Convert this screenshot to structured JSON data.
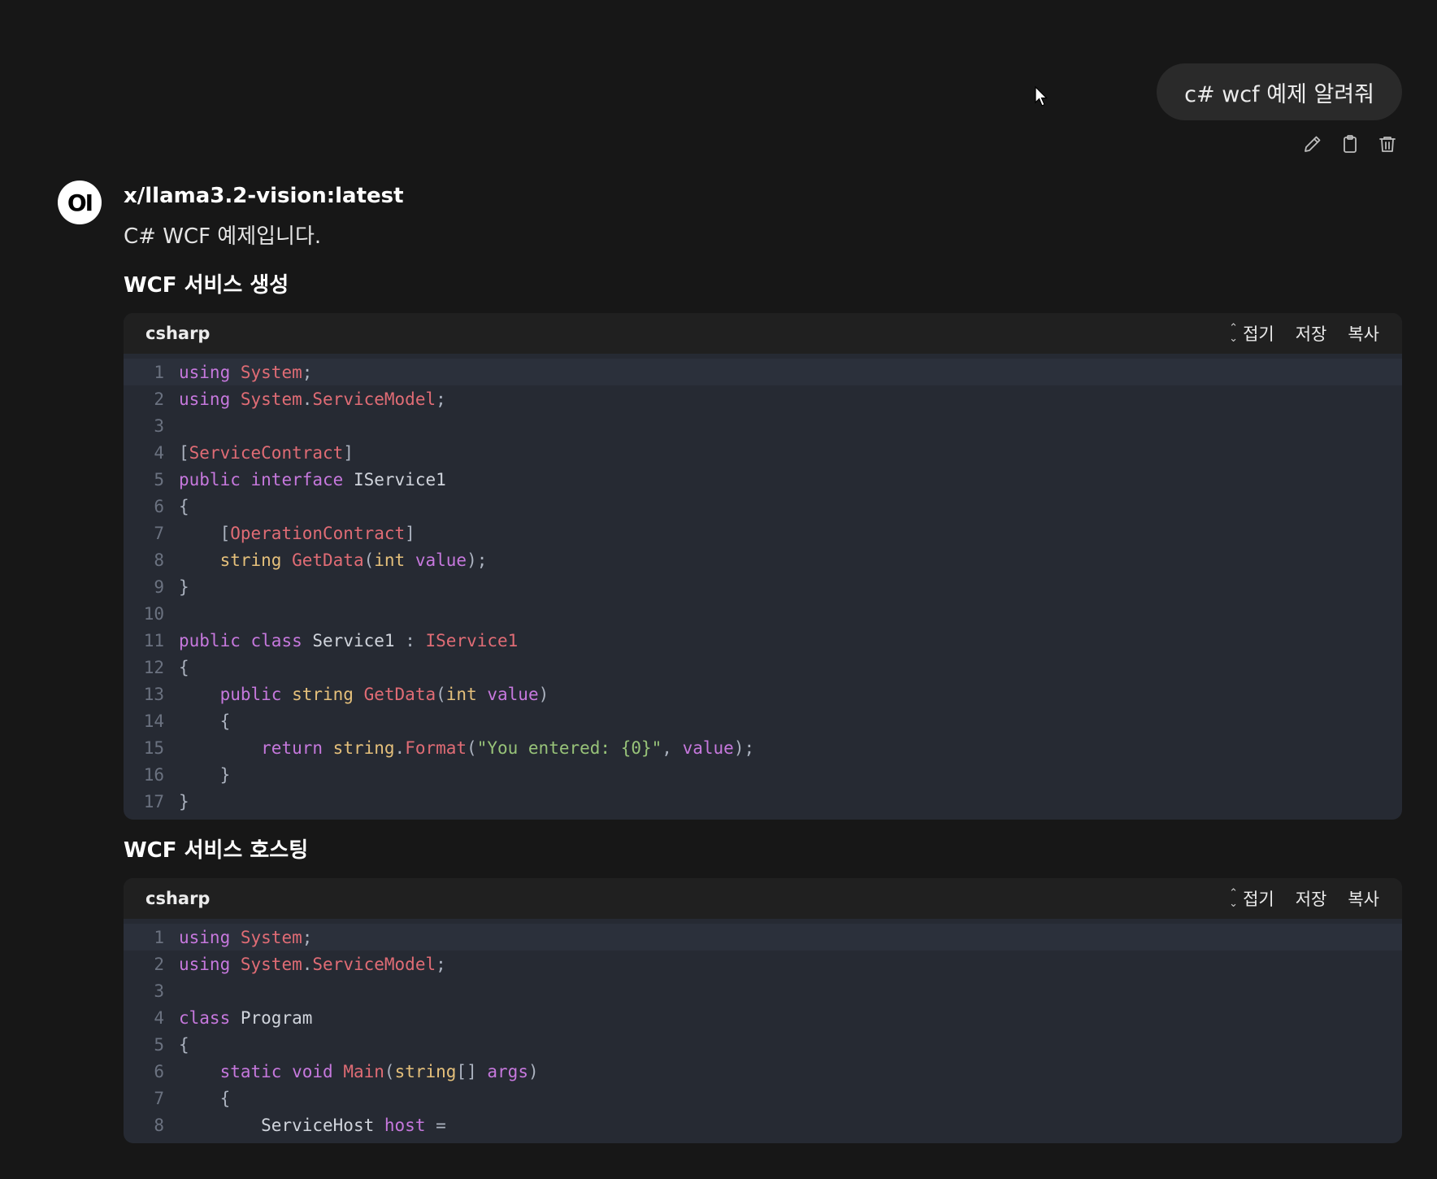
{
  "user_message": {
    "text": "c# wcf 예제 알려줘",
    "actions": [
      "edit-icon",
      "copy-icon",
      "delete-icon"
    ]
  },
  "assistant": {
    "avatar_text": "OI",
    "model_name": "x/llama3.2-vision:latest",
    "intro": "C# WCF 예제입니다.",
    "sections": [
      {
        "heading": "WCF 서비스 생성",
        "code_block": {
          "language": "csharp",
          "actions": {
            "collapse": "접기",
            "save": "저장",
            "copy": "복사"
          },
          "lines": [
            "using System;",
            "using System.ServiceModel;",
            "",
            "[ServiceContract]",
            "public interface IService1",
            "{",
            "    [OperationContract]",
            "    string GetData(int value);",
            "}",
            "",
            "public class Service1 : IService1",
            "{",
            "    public string GetData(int value)",
            "    {",
            "        return string.Format(\"You entered: {0}\", value);",
            "    }",
            "}"
          ]
        }
      },
      {
        "heading": "WCF 서비스 호스팅",
        "code_block": {
          "language": "csharp",
          "actions": {
            "collapse": "접기",
            "save": "저장",
            "copy": "복사"
          },
          "lines": [
            "using System;",
            "using System.ServiceModel;",
            "",
            "class Program",
            "{",
            "    static void Main(string[] args)",
            "    {",
            "        ServiceHost host ="
          ]
        }
      }
    ]
  },
  "colors": {
    "background": "#171717",
    "bubble": "#2a2a2a",
    "code_bg": "#262a33",
    "code_header_bg": "#202020",
    "keyword": "#c678dd",
    "type": "#e5c07b",
    "function": "#e06c75",
    "string": "#98c379"
  }
}
